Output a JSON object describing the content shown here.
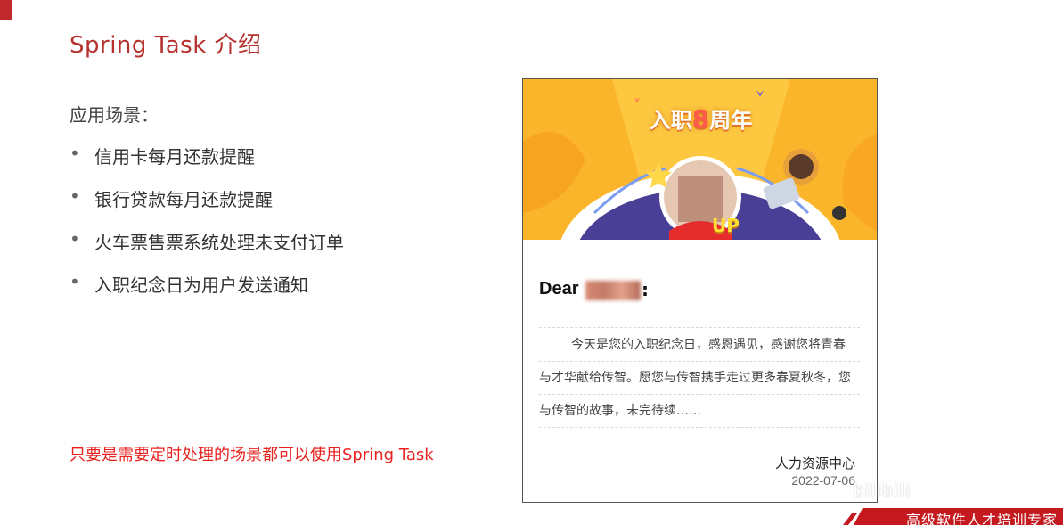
{
  "slide": {
    "title": "Spring Task 介绍",
    "scene_label": "应用场景：",
    "bullets": [
      "信用卡每月还款提醒",
      "银行贷款每月还款提醒",
      "火车票售票系统处理未支付订单",
      "入职纪念日为用户发送通知"
    ],
    "highlight": "只要是需要定时处理的场景都可以使用Spring Task"
  },
  "card": {
    "heading_prefix": "入职",
    "heading_number": "8",
    "heading_suffix": "周年",
    "badge": "UP",
    "greeting": "Dear",
    "greeting_colon": ":",
    "letter_lines": [
      "今天是您的入职纪念日，感恩遇见，感谢您将青春",
      "与才华献给传智。愿您与传智携手走过更多春夏秋冬，您",
      "与传智的故事，未完待续……"
    ],
    "signature": "人力资源中心",
    "date": "2022-07-06"
  },
  "footer": {
    "watermark": "bilibili",
    "slogan": "高级软件人才培训专家"
  },
  "colors": {
    "title_red": "#b5322e",
    "highlight_red": "#e8221f",
    "banner_orange": "#fbb52a",
    "arc_purple": "#4a3f96",
    "footer_red": "#c41a1f"
  }
}
